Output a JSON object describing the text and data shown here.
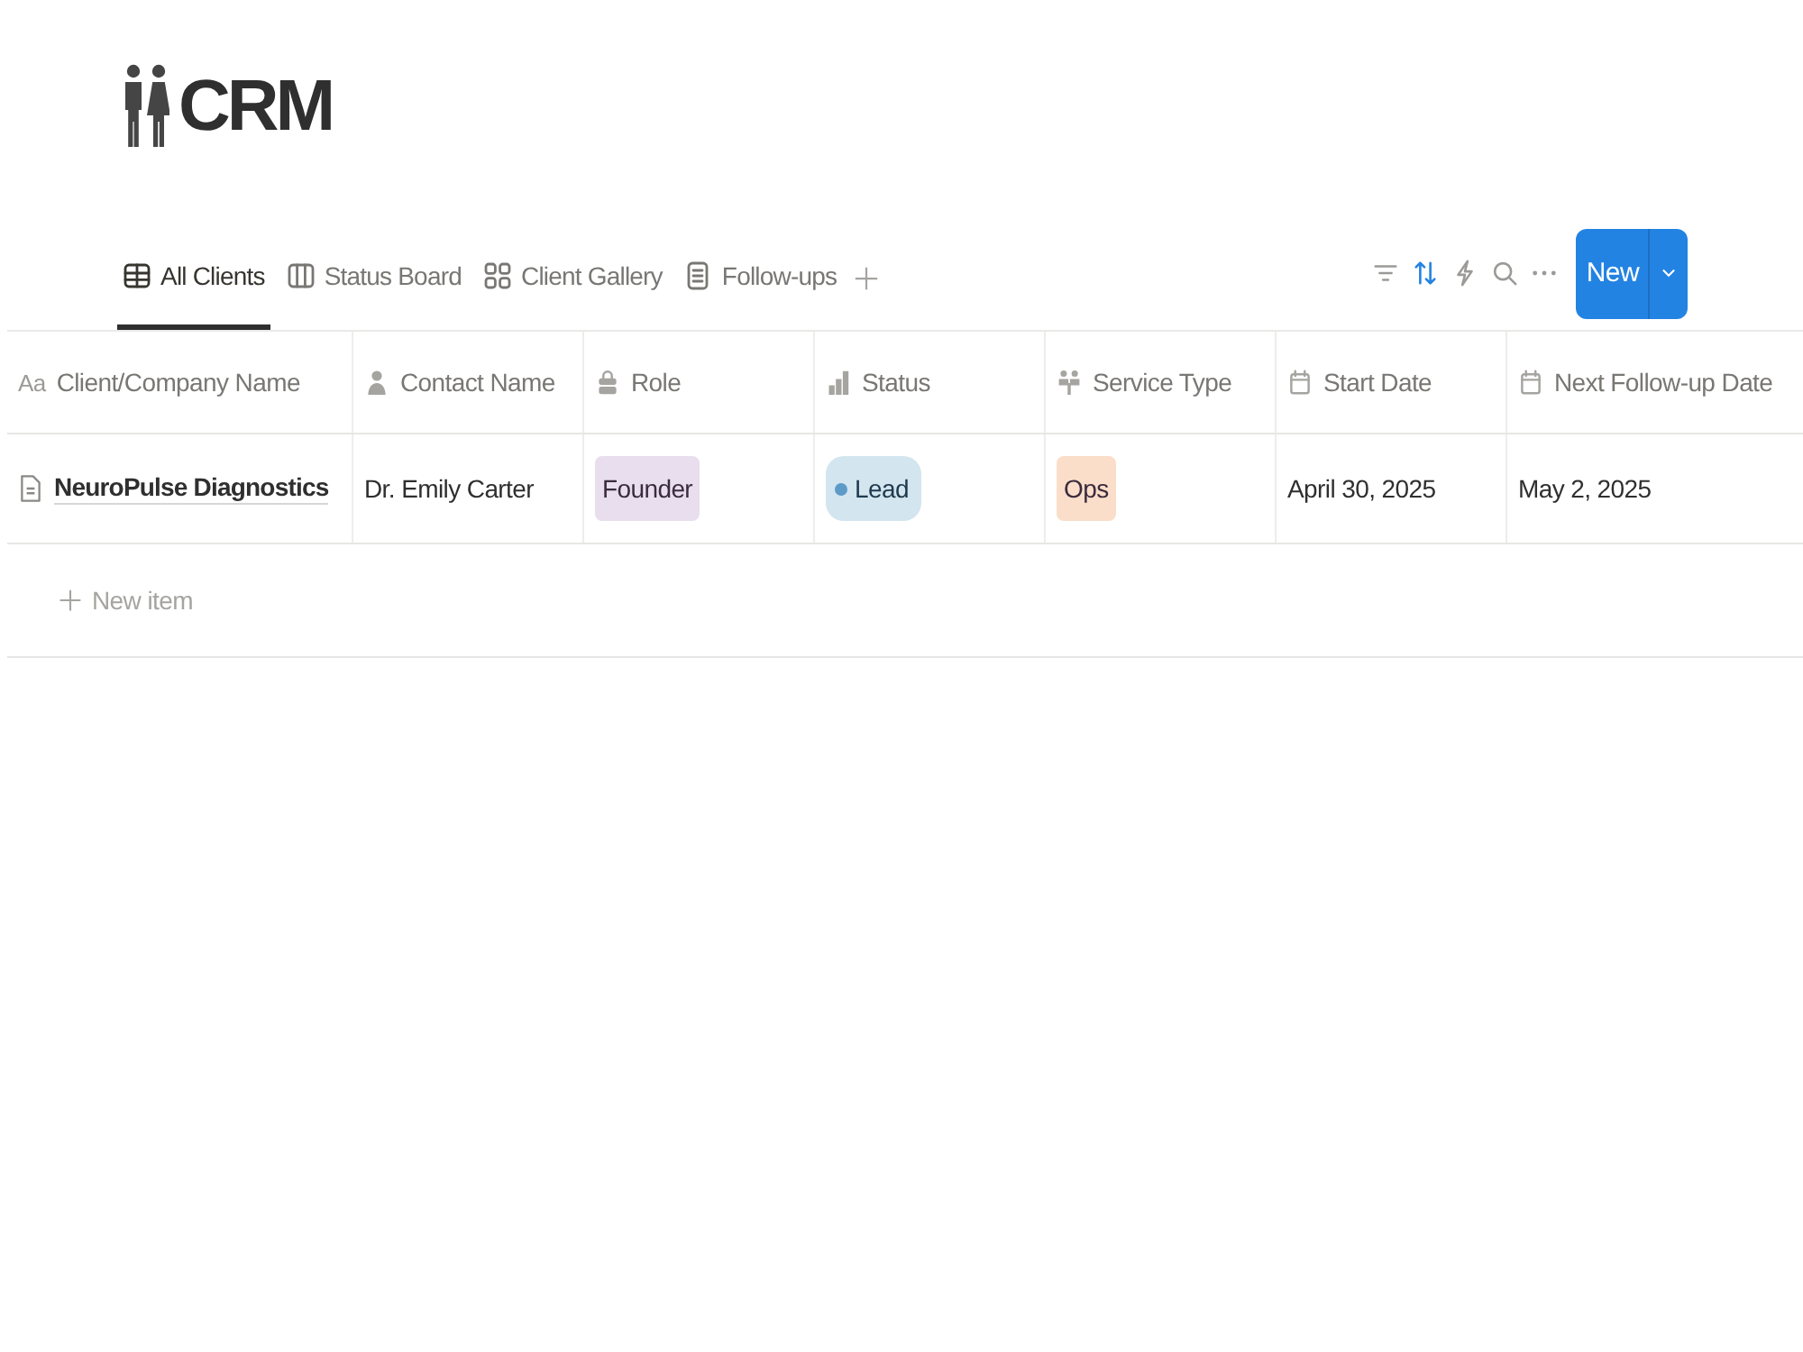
{
  "page": {
    "title": "CRM"
  },
  "views": [
    {
      "label": "All Clients",
      "kind": "table",
      "selected": true
    },
    {
      "label": "Status Board",
      "kind": "board",
      "selected": false
    },
    {
      "label": "Client Gallery",
      "kind": "gallery",
      "selected": false
    },
    {
      "label": "Follow-ups",
      "kind": "list",
      "selected": false
    }
  ],
  "toolbar": {
    "tools": [
      {
        "kind": "filter",
        "active": false
      },
      {
        "kind": "sort",
        "active": true
      },
      {
        "kind": "automation",
        "active": false
      },
      {
        "kind": "search",
        "active": false
      },
      {
        "kind": "more",
        "active": false
      }
    ],
    "new_button": "New"
  },
  "table": {
    "columns": [
      {
        "kind": "title",
        "icon_label": "Aa",
        "label": "Client/Company Name"
      },
      {
        "kind": "person",
        "label": "Contact Name"
      },
      {
        "kind": "select",
        "label": "Role"
      },
      {
        "kind": "status",
        "label": "Status"
      },
      {
        "kind": "multi_select",
        "label": "Service Type"
      },
      {
        "kind": "date",
        "label": "Start Date"
      },
      {
        "kind": "date",
        "label": "Next Follow-up Date"
      }
    ],
    "rows": [
      {
        "cells": [
          {
            "kind": "title",
            "text": "NeuroPulse Diagnostics"
          },
          {
            "kind": "text",
            "text": "Dr. Emily Carter"
          },
          {
            "kind": "tag",
            "text": "Founder",
            "color": "#e8deee"
          },
          {
            "kind": "status",
            "text": "Lead",
            "color": "#d3e5ef"
          },
          {
            "kind": "tag",
            "text": "Ops",
            "color": "#fadec9"
          },
          {
            "kind": "text",
            "text": "April 30, 2025"
          },
          {
            "kind": "text",
            "text": "May 2, 2025"
          }
        ]
      }
    ],
    "new_item": "New item"
  }
}
